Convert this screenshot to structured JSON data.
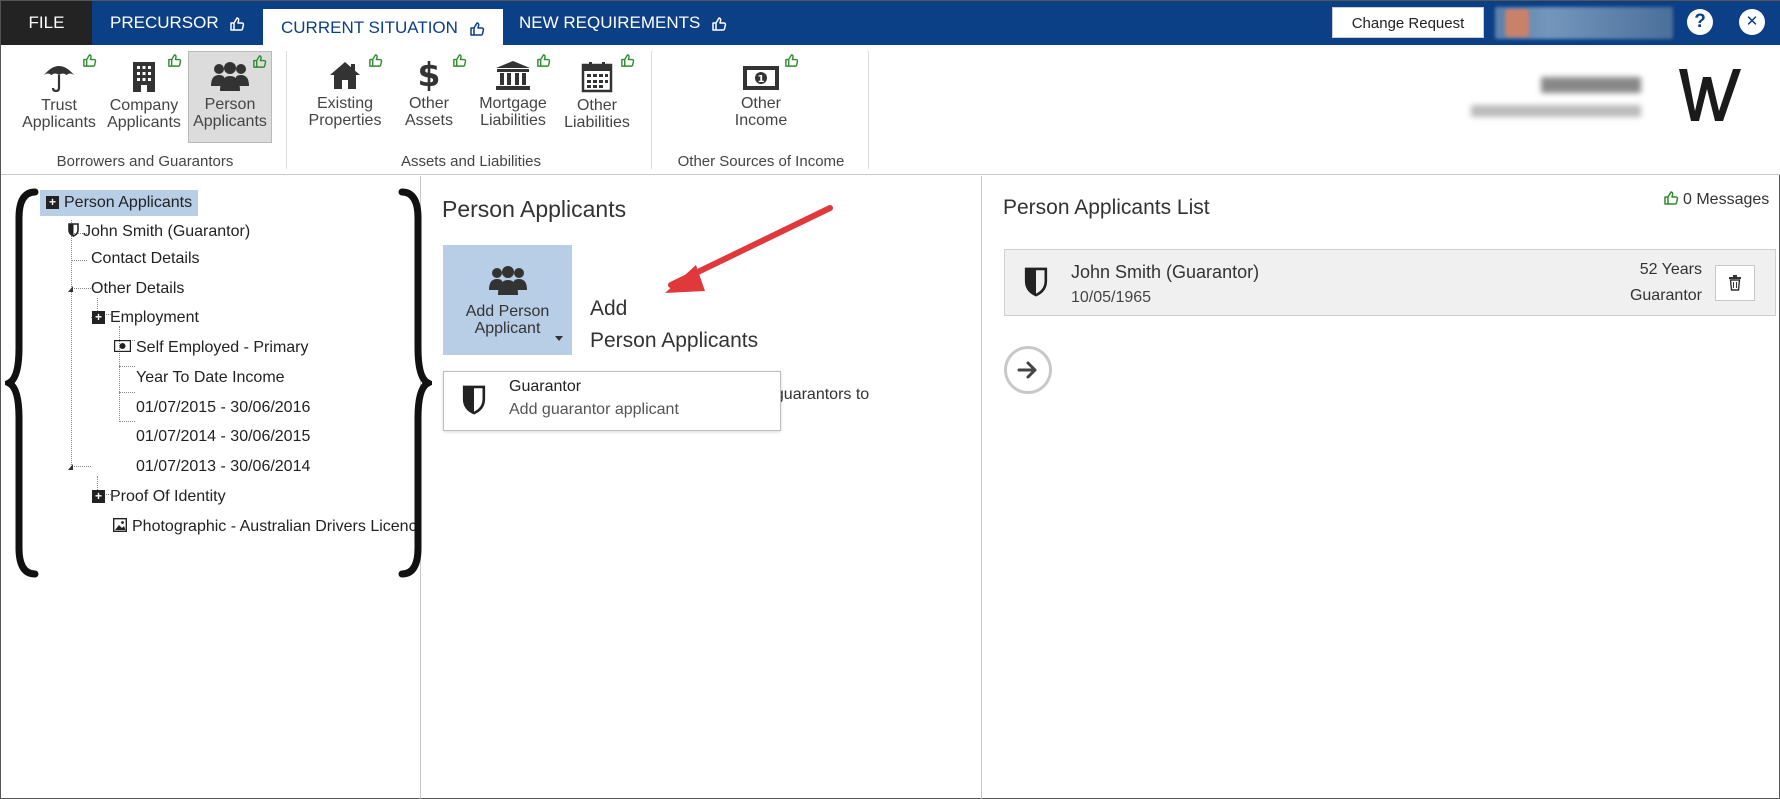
{
  "topbar": {
    "tabs": [
      {
        "label": "FILE"
      },
      {
        "label": "PRECURSOR"
      },
      {
        "label": "CURRENT SITUATION"
      },
      {
        "label": "NEW REQUIREMENTS"
      }
    ],
    "change_request_label": "Change Request",
    "help_label": "?",
    "close_label": "✕"
  },
  "ribbon": {
    "groups": [
      {
        "label": "Borrowers and Guarantors",
        "items": [
          {
            "line1": "Trust",
            "line2": "Applicants",
            "icon": "umbrella-icon"
          },
          {
            "line1": "Company",
            "line2": "Applicants",
            "icon": "building-icon"
          },
          {
            "line1": "Person",
            "line2": "Applicants",
            "icon": "people-icon"
          }
        ]
      },
      {
        "label": "Assets and Liabilities",
        "items": [
          {
            "line1": "Existing",
            "line2": "Properties",
            "icon": "house-icon"
          },
          {
            "line1": "Other",
            "line2": "Assets",
            "icon": "dollar-icon"
          },
          {
            "line1": "Mortgage",
            "line2": "Liabilities",
            "icon": "bank-icon"
          },
          {
            "line1": "Other",
            "line2": "Liabilities",
            "icon": "calendar-icon"
          }
        ]
      },
      {
        "label": "Other Sources of Income",
        "items": [
          {
            "line1": "Other",
            "line2": "Income",
            "icon": "banknote-icon"
          }
        ]
      }
    ]
  },
  "tree": {
    "root": "Person Applicants",
    "applicant": "John Smith (Guarantor)",
    "contact": "Contact Details",
    "other": "Other Details",
    "employment": "Employment",
    "self_employed": "Self Employed - Primary",
    "ytd": "Year To Date Income",
    "period1": "01/07/2015 - 30/06/2016",
    "period2": "01/07/2014 - 30/06/2015",
    "period3": "01/07/2013 - 30/06/2014",
    "proof": "Proof Of Identity",
    "photo": "Photographic - Australian Drivers Licence"
  },
  "middle": {
    "title": "Person Applicants",
    "add_button_line1": "Add Person",
    "add_button_line2": "Applicant",
    "add_text_line1": "Add",
    "add_text_line2": "Person Applicants",
    "description_partial": "wers or guarantors to",
    "dropdown": {
      "title": "Guarantor",
      "subtitle": "Add guarantor applicant"
    }
  },
  "right": {
    "title": "Person Applicants List",
    "messages": "0 Messages",
    "applicants": [
      {
        "name": "John Smith (Guarantor)",
        "dob": "10/05/1965",
        "age": "52 Years",
        "role": "Guarantor"
      }
    ]
  },
  "colors": {
    "topbar": "#0b3f86",
    "file_tab": "#232323",
    "selected": "#b8cde6",
    "thumb_green": "#2e8b2e",
    "annotation_arrow": "#e0393b"
  }
}
